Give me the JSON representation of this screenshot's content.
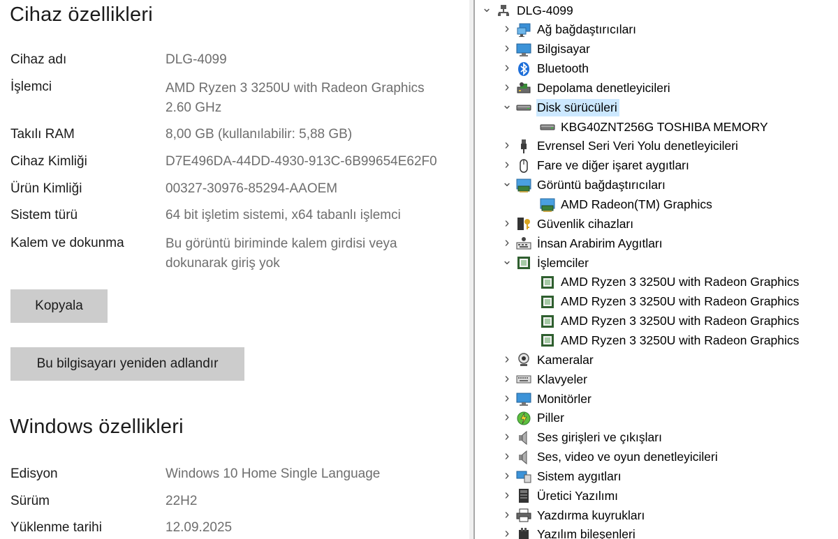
{
  "device_specs": {
    "title": "Cihaz özellikleri",
    "rows": [
      {
        "label": "Cihaz adı",
        "value": "DLG-4099"
      },
      {
        "label": "İşlemci",
        "value": "AMD Ryzen 3 3250U with Radeon Graphics",
        "value2": "2.60 GHz"
      },
      {
        "label": "Takılı RAM",
        "value": "8,00 GB (kullanılabilir: 5,88 GB)"
      },
      {
        "label": "Cihaz Kimliği",
        "value": "D7E496DA-44DD-4930-913C-6B99654E62F0"
      },
      {
        "label": "Ürün Kimliği",
        "value": "00327-30976-85294-AAOEM"
      },
      {
        "label": "Sistem türü",
        "value": "64 bit işletim sistemi, x64 tabanlı işlemci"
      },
      {
        "label": "Kalem ve dokunma",
        "value": "Bu görüntü biriminde kalem girdisi veya",
        "value2": "dokunarak giriş yok"
      }
    ],
    "copy_button": "Kopyala",
    "rename_button": "Bu bilgisayarı yeniden adlandır"
  },
  "windows_specs": {
    "title": "Windows özellikleri",
    "rows": [
      {
        "label": "Edisyon",
        "value": "Windows 10 Home Single Language"
      },
      {
        "label": "Sürüm",
        "value": "22H2"
      },
      {
        "label": "Yüklenme tarihi",
        "value": "12.09.2025"
      }
    ]
  },
  "device_manager": {
    "root": {
      "label": "DLG-4099",
      "icon": "computer-root-icon"
    },
    "nodes": [
      {
        "label": "Ağ bağdaştırıcıları",
        "icon": "network-adapter-icon",
        "state": "collapsed"
      },
      {
        "label": "Bilgisayar",
        "icon": "monitor-computer-icon",
        "state": "collapsed"
      },
      {
        "label": "Bluetooth",
        "icon": "bluetooth-icon",
        "state": "collapsed"
      },
      {
        "label": "Depolama denetleyicileri",
        "icon": "storage-controller-icon",
        "state": "collapsed"
      },
      {
        "label": "Disk sürücüleri",
        "icon": "disk-drive-icon",
        "state": "expanded",
        "selected": true,
        "children": [
          {
            "label": "KBG40ZNT256G TOSHIBA MEMORY",
            "icon": "disk-drive-icon"
          }
        ]
      },
      {
        "label": "Evrensel Seri Veri Yolu denetleyicileri",
        "icon": "usb-icon",
        "state": "collapsed"
      },
      {
        "label": "Fare ve diğer işaret aygıtları",
        "icon": "mouse-icon",
        "state": "collapsed"
      },
      {
        "label": "Görüntü bağdaştırıcıları",
        "icon": "display-adapter-icon",
        "state": "expanded",
        "children": [
          {
            "label": "AMD Radeon(TM) Graphics",
            "icon": "display-adapter-icon"
          }
        ]
      },
      {
        "label": "Güvenlik cihazları",
        "icon": "security-key-icon",
        "state": "collapsed"
      },
      {
        "label": "İnsan Arabirim Aygıtları",
        "icon": "hid-icon",
        "state": "collapsed"
      },
      {
        "label": "İşlemciler",
        "icon": "processor-icon",
        "state": "expanded",
        "children": [
          {
            "label": "AMD Ryzen 3 3250U with Radeon Graphics",
            "icon": "processor-icon"
          },
          {
            "label": "AMD Ryzen 3 3250U with Radeon Graphics",
            "icon": "processor-icon"
          },
          {
            "label": "AMD Ryzen 3 3250U with Radeon Graphics",
            "icon": "processor-icon"
          },
          {
            "label": "AMD Ryzen 3 3250U with Radeon Graphics",
            "icon": "processor-icon"
          }
        ]
      },
      {
        "label": "Kameralar",
        "icon": "camera-icon",
        "state": "collapsed"
      },
      {
        "label": "Klavyeler",
        "icon": "keyboard-icon",
        "state": "collapsed"
      },
      {
        "label": "Monitörler",
        "icon": "monitor-icon",
        "state": "collapsed"
      },
      {
        "label": "Piller",
        "icon": "battery-icon",
        "state": "collapsed"
      },
      {
        "label": "Ses girişleri ve çıkışları",
        "icon": "speaker-icon",
        "state": "collapsed"
      },
      {
        "label": "Ses, video ve oyun denetleyicileri",
        "icon": "speaker-icon",
        "state": "collapsed"
      },
      {
        "label": "Sistem aygıtları",
        "icon": "system-device-icon",
        "state": "collapsed"
      },
      {
        "label": "Üretici Yazılımı",
        "icon": "firmware-icon",
        "state": "collapsed"
      },
      {
        "label": "Yazdırma kuyrukları",
        "icon": "printer-icon",
        "state": "collapsed"
      },
      {
        "label": "Yazılım bileşenleri",
        "icon": "software-component-icon",
        "state": "collapsed"
      }
    ]
  }
}
